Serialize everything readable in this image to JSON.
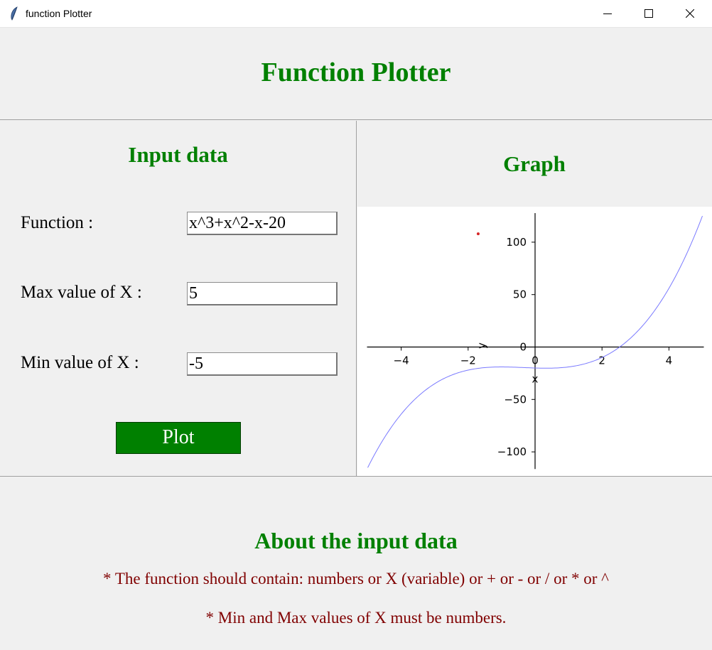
{
  "window": {
    "title": "function Plotter",
    "minimize_icon": "minimize-icon",
    "maximize_icon": "maximize-icon",
    "close_icon": "close-icon",
    "app_icon": "feather-icon"
  },
  "header": {
    "title": "Function Plotter"
  },
  "input_panel": {
    "title": "Input data",
    "function_label": "Function :",
    "function_value": "x^3+x^2-x-20",
    "max_label": "Max value of X :",
    "max_value": "5",
    "min_label": "Min value of X :",
    "min_value": "-5",
    "plot_button": "Plot"
  },
  "graph_panel": {
    "title": "Graph"
  },
  "chart_data": {
    "type": "line",
    "expression": "x^3+x^2-x-20",
    "series": [
      {
        "x": [
          -5,
          -4,
          -3,
          -2,
          -1,
          0,
          1,
          2,
          3,
          4,
          5
        ],
        "y": [
          -115,
          -64,
          -35,
          -22,
          -19,
          -20,
          -19,
          -10,
          13,
          56,
          125
        ]
      }
    ],
    "xlabel": "x",
    "ylabel": "y",
    "xlim": [
      -5,
      5
    ],
    "ylim": [
      -115,
      125
    ],
    "xticks": [
      -4,
      -2,
      0,
      2,
      4
    ],
    "yticks": [
      -100,
      -50,
      0,
      50,
      100
    ],
    "line_color": "#7a7aff",
    "marker_color": "#d62728",
    "grid": false
  },
  "about": {
    "title": "About the input data",
    "note1": "* The function should contain: numbers or X (variable) or + or - or / or * or ^",
    "note2": "* Min and Max values of X must be numbers."
  },
  "colors": {
    "accent": "#008000",
    "note": "#800000",
    "background": "#f0f0f0"
  }
}
